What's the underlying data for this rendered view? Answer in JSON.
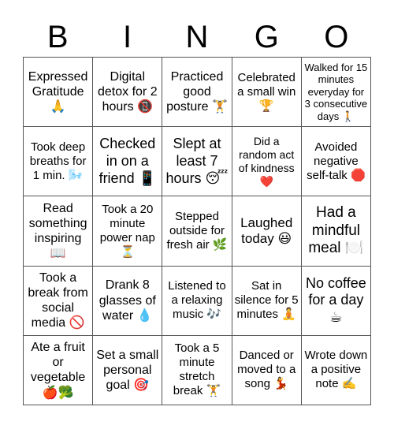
{
  "title_letters": [
    "B",
    "I",
    "N",
    "G",
    "O"
  ],
  "cells": [
    {
      "text": "Expressed Gratitude 🙏",
      "icon": "folded-hands"
    },
    {
      "text": "Digital detox for 2 hours 📵",
      "icon": "no-mobile-phones"
    },
    {
      "text": "Practiced good posture 🏋️",
      "icon": "weight-lifter"
    },
    {
      "text": "Celebrated a small win 🏆",
      "icon": "trophy"
    },
    {
      "text": "Walked for 15 minutes everyday for 3 consecutive days 🚶",
      "icon": "walking-person"
    },
    {
      "text": "Took deep breaths for 1 min. 🌬️",
      "icon": "wind-face"
    },
    {
      "text": "Checked in on a friend 📱",
      "icon": "mobile-phone"
    },
    {
      "text": "Slept at least 7 hours 😴",
      "icon": "sleeping-face"
    },
    {
      "text": "Did a random act of kindness ❤️",
      "icon": "red-heart"
    },
    {
      "text": "Avoided negative self-talk 🛑",
      "icon": "stop-sign"
    },
    {
      "text": "Read something inspiring 📖",
      "icon": "open-book"
    },
    {
      "text": "Took a 20 minute power nap ⏳",
      "icon": "hourglass"
    },
    {
      "text": "Stepped outside for fresh air 🌿",
      "icon": "herb"
    },
    {
      "text": "Laughed today 😃",
      "icon": "smiling-face"
    },
    {
      "text": "Had a mindful meal 🍽️",
      "icon": "plate-with-cutlery"
    },
    {
      "text": "Took a break from social media 🚫",
      "icon": "prohibited"
    },
    {
      "text": "Drank 8 glasses of water 💧",
      "icon": "droplet"
    },
    {
      "text": "Listened to a relaxing music 🎶",
      "icon": "musical-notes"
    },
    {
      "text": "Sat in silence for 5 minutes 🧘",
      "icon": "meditating-person"
    },
    {
      "text": "No coffee for a day ☕",
      "icon": "hot-beverage"
    },
    {
      "text": "Ate a fruit or vegetable 🍎🥦",
      "icon": "apple-broccoli"
    },
    {
      "text": "Set a small personal goal 🎯",
      "icon": "direct-hit"
    },
    {
      "text": "Took a 5 minute stretch break 🏋️",
      "icon": "weight-lifter"
    },
    {
      "text": "Danced or moved to a song 💃",
      "icon": "dancer"
    },
    {
      "text": "Wrote down a positive note ✍️",
      "icon": "writing-hand"
    }
  ]
}
